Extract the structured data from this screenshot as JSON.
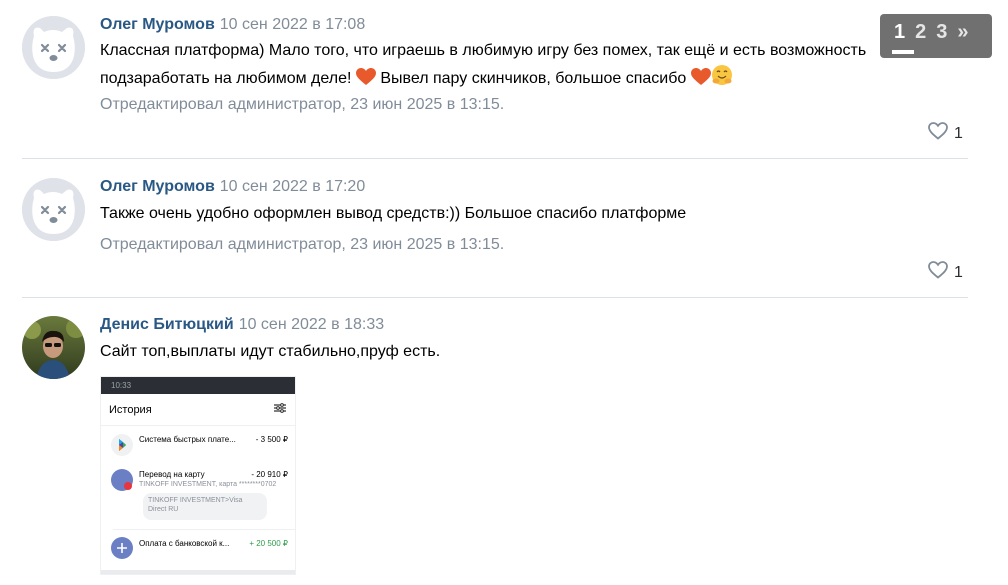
{
  "pager": {
    "pages": [
      "1",
      "2",
      "3"
    ],
    "current": "1",
    "next": "»"
  },
  "comments": [
    {
      "author": "Олег Муромов",
      "date": "10 сен 2022 в 17:08",
      "text_part1": "Классная платформа) Мало того, что играешь в любимую игру без помех, так ещё и есть возможность подзаработать на любимом деле!",
      "text_part2": "Вывел пару скинчиков, большое спасибо",
      "edited": "Отредактировал администратор, 23 июн 2025 в 13:15.",
      "likes": "1",
      "avatar": "deactivated-dog-avatar"
    },
    {
      "author": "Олег Муромов",
      "date": "10 сен 2022 в 17:20",
      "text": "Также очень удобно оформлен вывод средств:)) Большое спасибо платформе",
      "edited": "Отредактировал администратор, 23 июн 2025 в 13:15.",
      "likes": "1",
      "avatar": "deactivated-dog-avatar"
    },
    {
      "author": "Денис Битюцкий",
      "date": "10 сен 2022 в 18:33",
      "text": "Сайт топ,выплаты идут стабильно,пруф есть.",
      "avatar": "user-photo-avatar",
      "attachment": {
        "status_time": "10:33",
        "title": "История",
        "rows": [
          {
            "title": "Система быстрых плате...",
            "amount": "- 3 500 ₽"
          },
          {
            "title": "Перевод на карту",
            "amount": "- 20 910 ₽",
            "sub": "TINKOFF INVESTMENT, карта ********0702",
            "bubble_line1": "TINKOFF INVESTMENT>Visa",
            "bubble_line2": "Direct      RU"
          },
          {
            "title": "Оплата с банковской к...",
            "amount": "+ 20 500 ₽"
          }
        ]
      }
    }
  ],
  "colors": {
    "author": "#2a5885",
    "meta": "#818c99",
    "divider": "#dce1e6",
    "pager_bg": "#5c5c5c"
  },
  "icons": [
    "heart-outline-icon",
    "heart-emoji-icon",
    "hugging-face-emoji-icon",
    "filter-icon",
    "sbp-logo-icon",
    "tinkoff-icon",
    "card-plus-icon"
  ]
}
